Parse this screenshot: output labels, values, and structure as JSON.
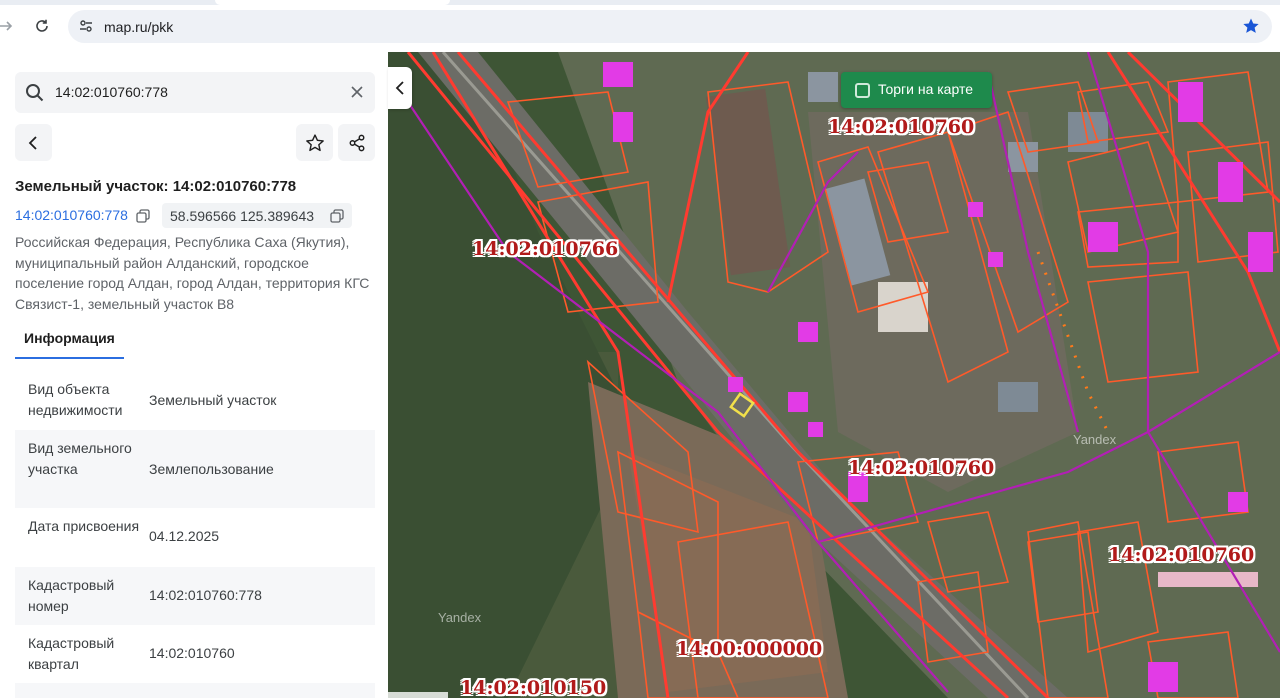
{
  "browser": {
    "url": "map.ru/pkk"
  },
  "panel": {
    "search_value": "14:02:010760:778",
    "title": "Земельный участок: 14:02:010760:778",
    "number_link": "14:02:010760:778",
    "coordinates": "58.596566 125.389643",
    "address": "Российская Федерация, Республика Саха (Якутия), муниципальный район Алданский, городское поселение город Алдан, город Алдан, территория КГС Связист-1, земельный участок В8",
    "tab_info": "Информация",
    "rows": [
      {
        "key": "Вид объекта недвижимости",
        "value": "Земельный участок"
      },
      {
        "key": "Вид земельного участка",
        "value": "Землепользование"
      },
      {
        "key": "Дата присвоения",
        "value": "04.12.2025"
      },
      {
        "key": "Кадастровый номер",
        "value": "14:02:010760:778"
      },
      {
        "key": "Кадастровый квартал",
        "value": "14:02:010760"
      }
    ]
  },
  "map": {
    "torgi_label": "Торги на карте",
    "labels": [
      "14:02:010760",
      "14:02:010766",
      "14:02:010760",
      "14:02:010760",
      "14:00:000000",
      "14:02:010150"
    ],
    "watermark_yandex": "Yandex",
    "watermark_yandex2": "Yandex"
  },
  "colors": {
    "accent": "#2b6ee0",
    "torgi_button": "#1e8a4c",
    "parcel_outline": "#ff5a2a",
    "boundary_purple": "#b21fb5",
    "label_red": "#b11a1a",
    "selected_parcel": "#f1e04a"
  }
}
